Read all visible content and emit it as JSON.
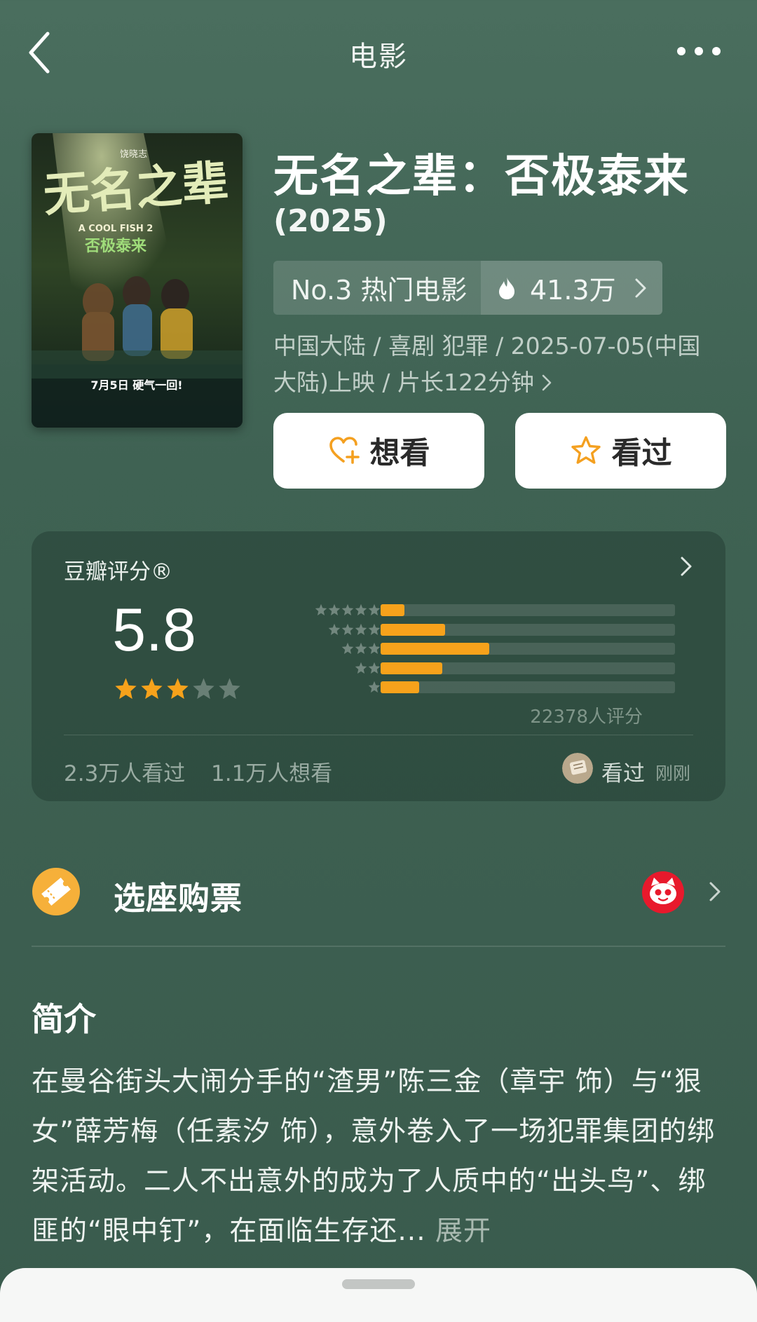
{
  "header": {
    "title": "电影",
    "back_icon": "chevron-left-icon",
    "more_icon": "more-dots-icon"
  },
  "movie": {
    "title": "无名之辈：否极泰来",
    "year": "(2025)",
    "rank_label": "No.3 热门电影",
    "heat": "41.3万",
    "meta": "中国大陆 / 喜剧 犯罪 / 2025-07-05(中国大陆)上映 / 片长122分钟",
    "poster": {
      "brand": "饶晓志",
      "title_art": "无名之辈",
      "english": "A COOL FISH 2",
      "subtitle_art": "否极泰来",
      "release": "7月5日 硬气一回!"
    }
  },
  "actions": {
    "want_label": "想看",
    "seen_label": "看过",
    "want_icon": "heart-plus-icon",
    "seen_icon": "star-outline-icon"
  },
  "rating": {
    "label": "豆瓣评分®",
    "score": "5.8",
    "stars_filled": 3,
    "stars_total": 5,
    "distribution": [
      {
        "stars": 5,
        "fraction": 0.08
      },
      {
        "stars": 4,
        "fraction": 0.22
      },
      {
        "stars": 3,
        "fraction": 0.37
      },
      {
        "stars": 2,
        "fraction": 0.21
      },
      {
        "stars": 1,
        "fraction": 0.13
      }
    ],
    "count": "22378人评分",
    "seen_count": "2.3万人看过",
    "want_count": "1.1万人想看",
    "friend_status": "看过",
    "friend_time": "刚刚"
  },
  "ticket": {
    "label": "选座购票",
    "icon": "ticket-icon",
    "partner_icon": "maoyan-cat-icon"
  },
  "intro": {
    "title": "简介",
    "text": "在曼谷街头大闹分手的“渣男”陈三金（章宇 饰）与“狠女”薛芳梅（任素汐 饰），意外卷入了一场犯罪集团的绑架活动。二人不出意外的成为了人质中的“出头鸟”、绑匪的“眼中钉”，在面临生存还...",
    "expand": "展开"
  },
  "colors": {
    "background": "#44685a",
    "accent": "#f7a21b",
    "card": "#ffffff"
  }
}
